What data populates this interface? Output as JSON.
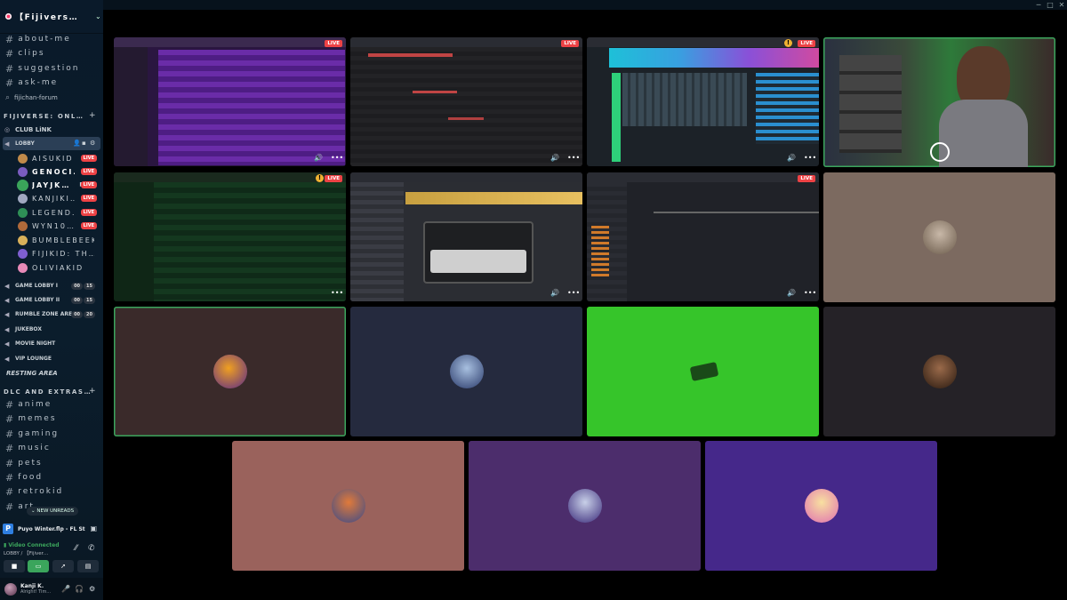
{
  "server": {
    "name": "【Fijivers…",
    "chevron": "⌄"
  },
  "text_channels_top": [
    {
      "name": "about-me"
    },
    {
      "name": "clips"
    },
    {
      "name": "suggestion"
    },
    {
      "name": "ask-me"
    }
  ],
  "forum": {
    "name": "fijichan-forum"
  },
  "category_fijiverse": "FIJIVERSE: ONL…",
  "club_link": "CLUB LiNK",
  "lobby": {
    "name": "LOBBY"
  },
  "members": [
    {
      "name": "AISUKID",
      "live": "LIVE",
      "color": "#c08a4a"
    },
    {
      "name": "GENOCI…",
      "live": "LIVE",
      "color": "#7a5cc0"
    },
    {
      "name": "JAYJK…",
      "live": "LIVE",
      "color": "#3aa45a"
    },
    {
      "name": "KANJIKI…",
      "live": "LIVE",
      "color": "#a0a8c0"
    },
    {
      "name": "LEGEND…",
      "live": "LIVE",
      "color": "#2e8f56"
    },
    {
      "name": "WYN10…",
      "live": "LIVE",
      "color": "#b06a3a"
    },
    {
      "name": "BUMBLEBEEK…",
      "live": "",
      "color": "#d9b05a"
    },
    {
      "name": "FIJIKID: TH…",
      "live": "",
      "color": "#7f5fd0"
    },
    {
      "name": "OLIVIAKID",
      "live": "",
      "color": "#e88ab8"
    }
  ],
  "voice_channels": [
    {
      "name": "GAME LOBBY I",
      "counts": [
        "00",
        "15"
      ]
    },
    {
      "name": "GAME LOBBY II",
      "counts": [
        "00",
        "15"
      ]
    },
    {
      "name": "RUMBLE ZONE ARE…",
      "counts": [
        "00",
        "20"
      ]
    },
    {
      "name": "JUKEBOX",
      "counts": []
    },
    {
      "name": "MOVIE NIGHT",
      "counts": []
    },
    {
      "name": "VIP LOUNGE",
      "counts": []
    }
  ],
  "resting_area": "RESTING AREA",
  "category_dlc": "DLC AND EXTRAS…",
  "text_channels_bottom": [
    {
      "name": "anime"
    },
    {
      "name": "memes"
    },
    {
      "name": "gaming"
    },
    {
      "name": "music"
    },
    {
      "name": "pets"
    },
    {
      "name": "food"
    },
    {
      "name": "retrokid"
    },
    {
      "name": "art"
    }
  ],
  "new_unreads": "NEW UNREADS",
  "activity": {
    "title": "Puyo Winter.flp - FL St…"
  },
  "voice_status": {
    "status": "Video Connected",
    "location": "LOBBY / 【Fijiver…"
  },
  "user": {
    "name": "Kanji K.",
    "status": "Alright! Tim…"
  },
  "live_label": "LIVE",
  "colors": {
    "live_red": "#ed4245",
    "connected_green": "#3ba55c",
    "warning": "#f0b232"
  },
  "tiles": [
    {
      "kind": "stream",
      "live": true,
      "theme": "purple-daw"
    },
    {
      "kind": "stream",
      "live": true,
      "theme": "red-daw"
    },
    {
      "kind": "stream",
      "live": true,
      "warning": true,
      "theme": "colorful-daw"
    },
    {
      "kind": "webcam",
      "speaking": true
    },
    {
      "kind": "stream",
      "live": true,
      "warning": true,
      "theme": "green-daw"
    },
    {
      "kind": "stream",
      "live": false,
      "theme": "amp-plugin"
    },
    {
      "kind": "stream",
      "live": true,
      "theme": "dark-daw"
    },
    {
      "kind": "avatar",
      "bg": "#7c6a60"
    },
    {
      "kind": "avatar",
      "bg": "#3a2a2a",
      "speaking": true
    },
    {
      "kind": "avatar",
      "bg": "#252a3e"
    },
    {
      "kind": "avatar",
      "bg": "#36c52a"
    },
    {
      "kind": "avatar",
      "bg": "#252227"
    },
    {
      "kind": "avatar",
      "bg": "#9a625c"
    },
    {
      "kind": "avatar",
      "bg": "#4c2d6c"
    },
    {
      "kind": "avatar",
      "bg": "#45288a"
    }
  ]
}
